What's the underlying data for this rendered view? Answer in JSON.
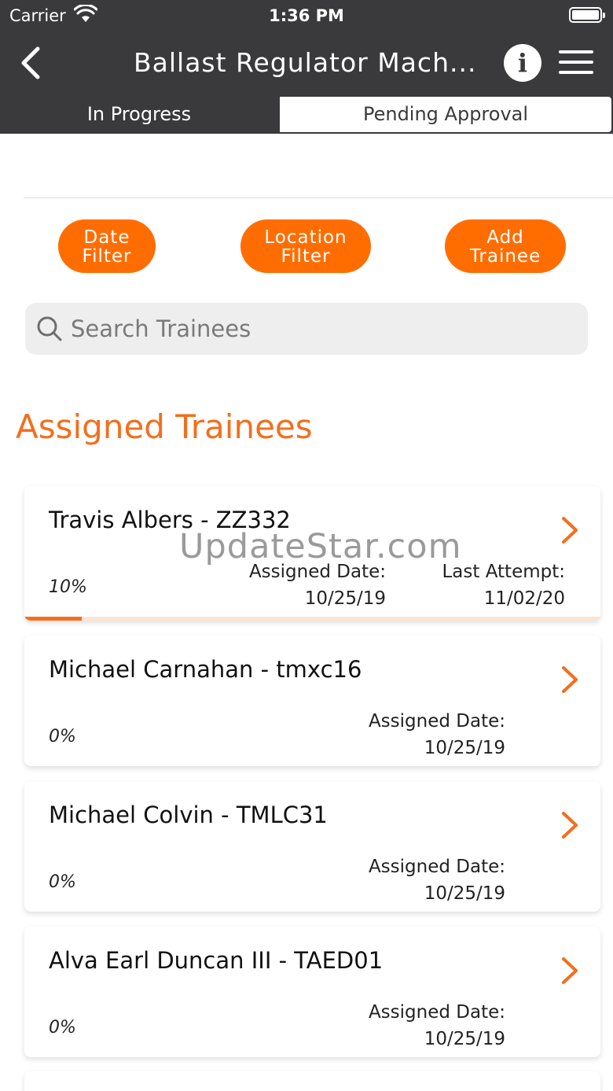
{
  "status_bar": {
    "carrier": "Carrier",
    "time": "1:36 PM"
  },
  "nav": {
    "title": "Ballast Regulator Mach...",
    "info_label": "i"
  },
  "tabs": [
    {
      "label": "In Progress",
      "selected": true
    },
    {
      "label": "Pending Approval",
      "selected": false
    }
  ],
  "filters": {
    "date_label": "Date\nFilter",
    "location_label": "Location\nFilter",
    "add_label": "Add\nTrainee"
  },
  "search": {
    "placeholder": "Search Trainees",
    "value": ""
  },
  "section": {
    "title": "Assigned Trainees"
  },
  "trainees": [
    {
      "name": "Travis Albers - ZZ332",
      "percent": "10%",
      "progress": 0.1,
      "assigned_label": "Assigned Date:",
      "assigned_date": "10/25/19",
      "last_label": "Last Attempt:",
      "last_date": "11/02/20"
    },
    {
      "name": "Michael Carnahan - tmxc16",
      "percent": "0%",
      "progress": 0,
      "assigned_label": "Assigned Date:",
      "assigned_date": "10/25/19"
    },
    {
      "name": "Michael Colvin - TMLC31",
      "percent": "0%",
      "progress": 0,
      "assigned_label": "Assigned Date:",
      "assigned_date": "10/25/19"
    },
    {
      "name": "Alva Earl Duncan III - TAED01",
      "percent": "0%",
      "progress": 0,
      "assigned_label": "Assigned Date:",
      "assigned_date": "10/25/19"
    }
  ],
  "watermark": "UpdateStar.com",
  "colors": {
    "accent": "#ff6d00",
    "title_orange": "#f26f1e",
    "header_bg": "#3a3a3c"
  },
  "icons": {
    "back": "chevron-left-icon",
    "info": "info-icon",
    "menu": "hamburger-menu-icon",
    "search": "search-icon",
    "row": "chevron-right-icon"
  }
}
